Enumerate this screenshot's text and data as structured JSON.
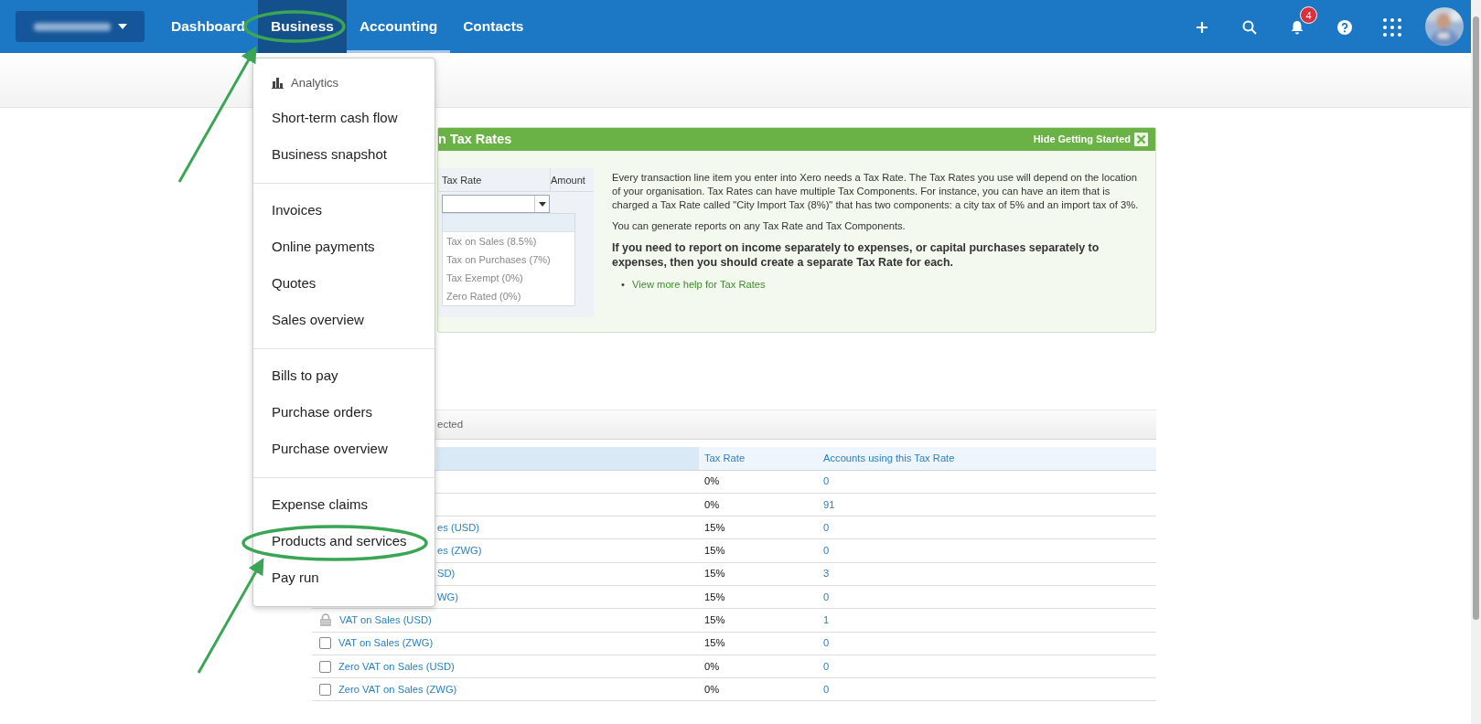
{
  "navbar": {
    "items": [
      {
        "label": "Dashboard",
        "open": false,
        "selected": false
      },
      {
        "label": "Business",
        "open": true,
        "selected": false
      },
      {
        "label": "Accounting",
        "open": false,
        "selected": true
      },
      {
        "label": "Contacts",
        "open": false,
        "selected": false
      }
    ],
    "notification_count": "4"
  },
  "menu": {
    "sections": [
      {
        "heading": "Analytics",
        "items": [
          "Short-term cash flow",
          "Business snapshot"
        ]
      },
      {
        "items": [
          "Invoices",
          "Online payments",
          "Quotes",
          "Sales overview"
        ]
      },
      {
        "items": [
          "Bills to pay",
          "Purchase orders",
          "Purchase overview"
        ]
      },
      {
        "items": [
          "Expense claims",
          "Products and services",
          "Pay run"
        ]
      }
    ]
  },
  "getting_started": {
    "title": "n Tax Rates",
    "hide_label": "Hide Getting Started",
    "example": {
      "columns": [
        "Tax Rate",
        "Amount"
      ],
      "options": [
        "Tax on Sales (8.5%)",
        "Tax on Purchases (7%)",
        "Tax Exempt (0%)",
        "Zero Rated (0%)"
      ]
    },
    "paragraphs": [
      "Every transaction line item you enter into Xero needs a Tax Rate. The Tax Rates you use will depend on the location of your organisation. Tax Rates can have multiple Tax Components. For instance, you can have an item that is charged a Tax Rate called \"City Import Tax (8%)\" that has two components: a city tax of 5% and an import tax of 3%.",
      "You can generate reports on any Tax Rate and Tax Components."
    ],
    "emphasis": "If you need to report on income separately to expenses, or capital purchases separately to expenses, then you should create a separate Tax Rate for each.",
    "links": [
      {
        "bullet": "•",
        "label": "View more help for Tax Rates"
      }
    ]
  },
  "table": {
    "toolbar_text": "ected",
    "columns": [
      {
        "sorted": true
      },
      {
        "label": "Tax Rate",
        "sorted": false
      },
      {
        "label": "Accounts using this Tax Rate",
        "sorted": false
      }
    ],
    "rows": [
      {
        "kind": "covered",
        "rate": "0%",
        "accounts": "0"
      },
      {
        "kind": "covered",
        "rate": "0%",
        "accounts": "91"
      },
      {
        "kind": "covered",
        "name": "es (USD)",
        "rate": "15%",
        "accounts": "0"
      },
      {
        "kind": "covered",
        "name": "es (ZWG)",
        "rate": "15%",
        "accounts": "0"
      },
      {
        "kind": "covered",
        "name": "SD)",
        "rate": "15%",
        "accounts": "3"
      },
      {
        "kind": "covered",
        "name": "WG)",
        "rate": "15%",
        "accounts": "0"
      },
      {
        "kind": "locked",
        "name": "VAT on Sales (USD)",
        "rate": "15%",
        "accounts": "1"
      },
      {
        "kind": "checkbox",
        "checked": false,
        "name": "VAT on Sales (ZWG)",
        "rate": "15%",
        "accounts": "0"
      },
      {
        "kind": "checkbox",
        "checked": false,
        "name": "Zero VAT on Sales (USD)",
        "rate": "0%",
        "accounts": "0"
      },
      {
        "kind": "checkbox",
        "checked": false,
        "name": "Zero VAT on Sales (ZWG)",
        "rate": "0%",
        "accounts": "0"
      }
    ]
  }
}
